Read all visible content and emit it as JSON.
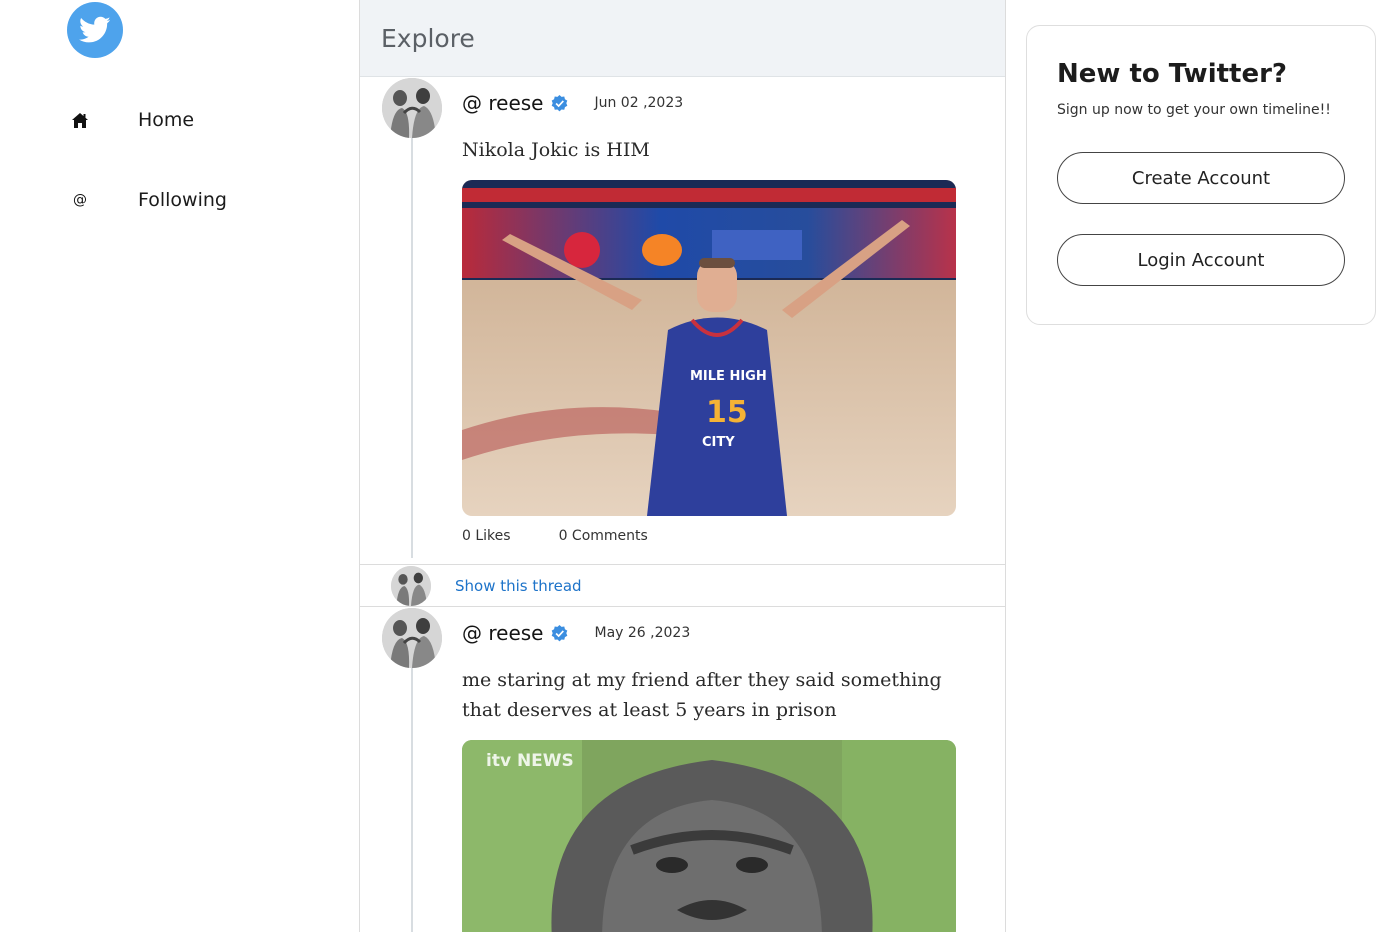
{
  "sidebar": {
    "logo_icon": "twitter-bird-icon",
    "items": [
      {
        "icon": "home-icon",
        "label": "Home"
      },
      {
        "icon": "at-icon",
        "icon_glyph": "@",
        "label": "Following"
      }
    ]
  },
  "main": {
    "header": "Explore",
    "tweets": [
      {
        "handle": "@ reese",
        "date": "Jun 02 ,2023",
        "text": "Nikola Jokic is HIM",
        "likes": "0 Likes",
        "comments": "0 Comments",
        "jersey": {
          "line1": "MILE HIGH",
          "number": "15",
          "line2": "CITY"
        }
      },
      {
        "handle": "@ reese",
        "date": "May 26 ,2023",
        "text": "me staring at my friend after they said something that deserves at least 5 years in prison",
        "media_watermark": "itv NEWS"
      }
    ],
    "show_thread": "Show this thread"
  },
  "signup": {
    "title": "New to Twitter?",
    "subtitle": "Sign up now to get your own timeline!!",
    "create_label": "Create Account",
    "login_label": "Login Account"
  },
  "colors": {
    "brand": "#4ea3ec",
    "link": "#1d73c9",
    "verified": "#3b8ee0",
    "header_bg": "#f0f3f6"
  }
}
